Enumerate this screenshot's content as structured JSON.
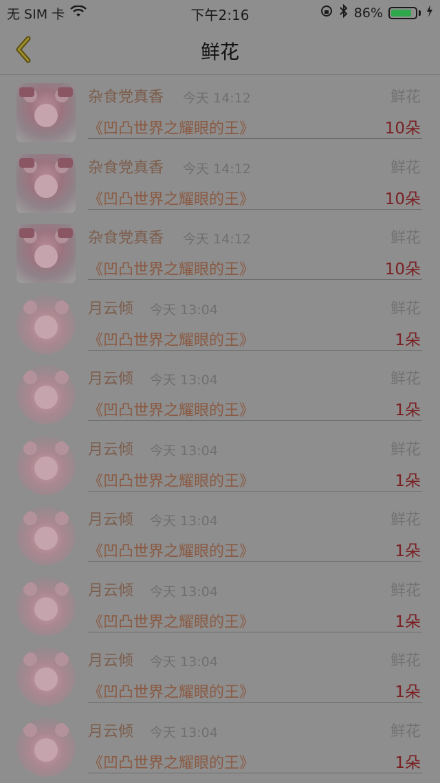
{
  "status_bar": {
    "carrier": "无 SIM 卡",
    "time": "下午2:16",
    "battery_percent": "86%",
    "battery_level": 0.86
  },
  "nav": {
    "title": "鲜花"
  },
  "rows": [
    {
      "name": "杂食党真香",
      "time": "今天 14:12",
      "type": "鲜花",
      "book": "《凹凸世界之耀眼的王》",
      "count": "10朵",
      "avatar": "v1"
    },
    {
      "name": "杂食党真香",
      "time": "今天 14:12",
      "type": "鲜花",
      "book": "《凹凸世界之耀眼的王》",
      "count": "10朵",
      "avatar": "v1"
    },
    {
      "name": "杂食党真香",
      "time": "今天 14:12",
      "type": "鲜花",
      "book": "《凹凸世界之耀眼的王》",
      "count": "10朵",
      "avatar": "v1"
    },
    {
      "name": "月云倾",
      "time": "今天 13:04",
      "type": "鲜花",
      "book": "《凹凸世界之耀眼的王》",
      "count": "1朵",
      "avatar": "v2"
    },
    {
      "name": "月云倾",
      "time": "今天 13:04",
      "type": "鲜花",
      "book": "《凹凸世界之耀眼的王》",
      "count": "1朵",
      "avatar": "v2"
    },
    {
      "name": "月云倾",
      "time": "今天 13:04",
      "type": "鲜花",
      "book": "《凹凸世界之耀眼的王》",
      "count": "1朵",
      "avatar": "v2"
    },
    {
      "name": "月云倾",
      "time": "今天 13:04",
      "type": "鲜花",
      "book": "《凹凸世界之耀眼的王》",
      "count": "1朵",
      "avatar": "v2"
    },
    {
      "name": "月云倾",
      "time": "今天 13:04",
      "type": "鲜花",
      "book": "《凹凸世界之耀眼的王》",
      "count": "1朵",
      "avatar": "v2"
    },
    {
      "name": "月云倾",
      "time": "今天 13:04",
      "type": "鲜花",
      "book": "《凹凸世界之耀眼的王》",
      "count": "1朵",
      "avatar": "v2"
    },
    {
      "name": "月云倾",
      "time": "今天 13:04",
      "type": "鲜花",
      "book": "《凹凸世界之耀眼的王》",
      "count": "1朵",
      "avatar": "v2"
    }
  ]
}
